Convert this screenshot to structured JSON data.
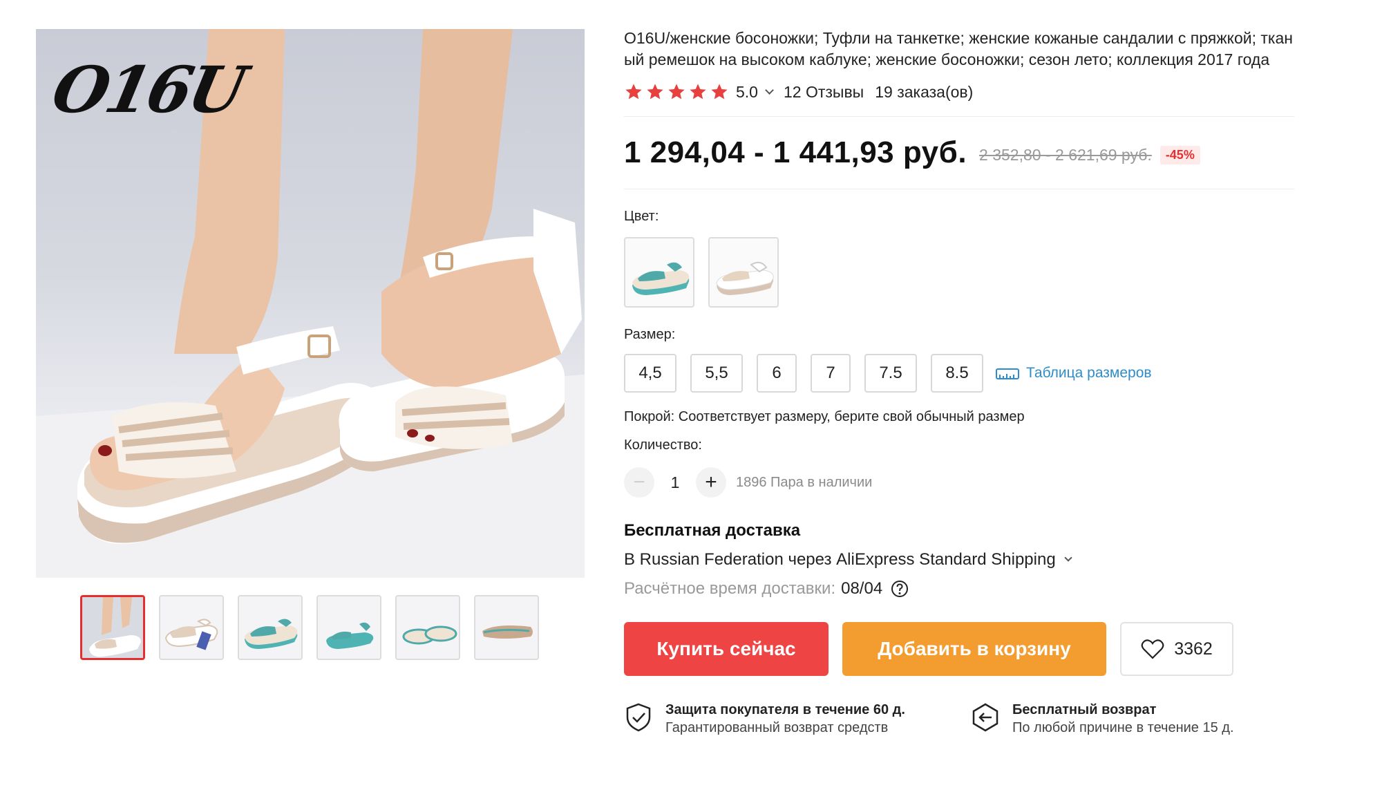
{
  "gallery": {
    "brand_logo_text": "O16U",
    "main_image_alt": "white and beige woven wedge sandals on feet",
    "thumbnails": [
      {
        "name": "thumb-1",
        "active": true
      },
      {
        "name": "thumb-2",
        "active": false
      },
      {
        "name": "thumb-3",
        "active": false
      },
      {
        "name": "thumb-4",
        "active": false
      },
      {
        "name": "thumb-5",
        "active": false
      },
      {
        "name": "thumb-6",
        "active": false
      }
    ]
  },
  "product": {
    "title": "O16U/женские босоножки; Туфли на танкетке; женские кожаные сандалии с пряжкой; тканый ремешок на высоком каблуке; женские босоножки; сезон лето; коллекция 2017 года",
    "rating": {
      "stars": 5,
      "value": "5.0",
      "reviews": "12 Отзывы",
      "orders": "19 заказа(ов)"
    },
    "price": {
      "current": "1 294,04 - 1 441,93 руб.",
      "old": "2 352,80 - 2 621,69 руб.",
      "discount": "-45%"
    },
    "color": {
      "label": "Цвет:"
    },
    "size": {
      "label": "Размер:",
      "options": [
        "4,5",
        "5,5",
        "6",
        "7",
        "7.5",
        "8.5"
      ],
      "size_table_link": "Таблица размеров"
    },
    "fit": "Покрой: Соответствует размеру, берите свой обычный размер",
    "quantity": {
      "label": "Количество:",
      "value": "1",
      "minus": "−",
      "plus": "+",
      "stock": "1896 Пара в наличии"
    },
    "delivery": {
      "title": "Бесплатная доставка",
      "route": "В Russian Federation через AliExpress Standard Shipping",
      "eta_label": "Расчётное время доставки:",
      "eta_value": "08/04"
    },
    "actions": {
      "buy_now": "Купить сейчас",
      "add_to_cart": "Добавить в корзину",
      "wishlist_count": "3362"
    },
    "guarantees": {
      "protection_title": "Защита покупателя в течение 60 д.",
      "protection_sub": "Гарантированный возврат средств",
      "return_title": "Бесплатный возврат",
      "return_sub": "По любой причине в течение 15 д."
    }
  },
  "colors": {
    "accent_red": "#ee4444",
    "accent_orange": "#f39c30",
    "link_blue": "#2d8cc9",
    "star_red": "#e8403f"
  }
}
